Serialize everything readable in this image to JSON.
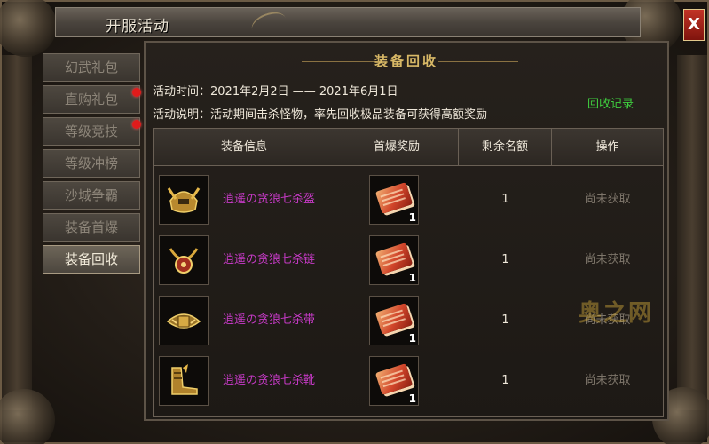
{
  "window": {
    "title": "开服活动",
    "close_label": "X"
  },
  "sidebar": {
    "items": [
      {
        "label": "幻武礼包",
        "active": false,
        "badge": false
      },
      {
        "label": "直购礼包",
        "active": false,
        "badge": true
      },
      {
        "label": "等级竞技",
        "active": false,
        "badge": true
      },
      {
        "label": "等级冲榜",
        "active": false,
        "badge": false
      },
      {
        "label": "沙城争霸",
        "active": false,
        "badge": false
      },
      {
        "label": "装备首爆",
        "active": false,
        "badge": false
      },
      {
        "label": "装备回收",
        "active": true,
        "badge": false
      }
    ]
  },
  "panel": {
    "heading": "装备回收",
    "time_text": "活动时间：2021年2月2日 —— 2021年6月1日",
    "desc_text": "活动说明：活动期间击杀怪物，率先回收极品装备可获得高额奖励",
    "record_link": "回收记录"
  },
  "table": {
    "headers": [
      "装备信息",
      "首爆奖励",
      "剩余名额",
      "操作"
    ],
    "rows": [
      {
        "equip_icon": "helmet-icon",
        "name": "逍遥の贪狼七杀盔",
        "reward_icon": "red-book-icon",
        "reward_qty": "1",
        "remaining": "1",
        "action": "尚未获取"
      },
      {
        "equip_icon": "necklace-icon",
        "name": "逍遥の贪狼七杀链",
        "reward_icon": "red-book-icon",
        "reward_qty": "1",
        "remaining": "1",
        "action": "尚未获取"
      },
      {
        "equip_icon": "belt-icon",
        "name": "逍遥の贪狼七杀带",
        "reward_icon": "red-book-icon",
        "reward_qty": "1",
        "remaining": "1",
        "action": "尚未获取"
      },
      {
        "equip_icon": "boots-icon",
        "name": "逍遥の贪狼七杀靴",
        "reward_icon": "red-book-icon",
        "reward_qty": "1",
        "remaining": "1",
        "action": "尚未获取"
      }
    ]
  },
  "watermark": "奥之网",
  "colors": {
    "accent_gold": "#d8b866",
    "item_name": "#c53ac5",
    "record_link": "#3fcf3f",
    "badge_red": "#e01b1b"
  }
}
